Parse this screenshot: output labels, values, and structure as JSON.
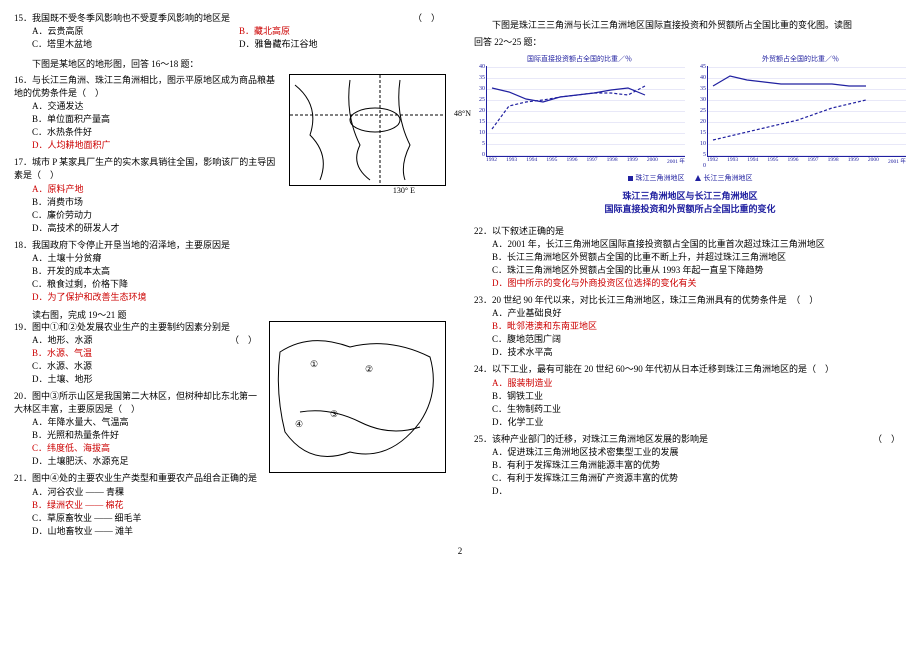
{
  "page_number": "2",
  "left": {
    "q15": {
      "num": "15．",
      "text": "我国既不受冬季风影响也不受夏季风影响的地区是",
      "paren": "（　）",
      "A": "A．云贵高原",
      "B": "B．藏北高原",
      "C": "C．塔里木盆地",
      "D": "D．雅鲁藏布江谷地"
    },
    "intro1": "下图是某地区的地形图，回答 16～18 题：",
    "map1": {
      "lat": "48°N",
      "lon": "130° E"
    },
    "q16": {
      "num": "16．",
      "text": "与长江三角洲、珠江三角洲相比，图示平原地区成为商品粮基地的优势条件是（　）",
      "A": "A．交通发达",
      "B": "B．单位面积产量高",
      "C": "C．水热条件好",
      "D": "D．人均耕地面积广"
    },
    "q17": {
      "num": "17．",
      "text": "城市 P 某家具厂生产的实木家具销往全国，影响该厂的主导因素是（　）",
      "A": "A．原料产地",
      "B": "B．消费市场",
      "C": "C．廉价劳动力",
      "D": "D．高技术的研发人才"
    },
    "q18": {
      "num": "18．",
      "text": "我国政府下令停止开垦当地的沼泽地，主要原因是",
      "A": "A．土壤十分贫瘠",
      "B": "B．开发的成本太高",
      "C": "C．粮食过剩，价格下降",
      "D": "D．为了保护和改善生态环境"
    },
    "intro2": "读右图，完成 19～21 题",
    "q19": {
      "num": "19．",
      "text": "图中①和②处发展农业生产的主要制约因素分别是",
      "paren": "（　）",
      "A": "A．地形、水源",
      "B": "B．水源、气温",
      "C": "C．水源、水源",
      "D": "D．土壤、地形"
    },
    "q20": {
      "num": "20．",
      "text": "图中③所示山区是我国第二大林区，但树种却比东北第一大林区丰富，主要原因是（　）",
      "A": "A．年降水量大、气温高",
      "B": "B．光照和热量条件好",
      "C": "C．纬度低、海拔高",
      "D": "D．土壤肥沃、水源充足"
    },
    "q21": {
      "num": "21．",
      "text": "图中④处的主要农业生产类型和重要农产品组合正确的是",
      "A": "A．河谷农业 —— 青稞",
      "B": "B．绿洲农业 —— 棉花",
      "C": "C．草原畜牧业 —— 细毛羊",
      "D": "D．山地畜牧业 —— 滩羊"
    }
  },
  "right": {
    "intro3": "下图是珠江三三角洲与长江三角洲地区国际直接投资和外贸额所占全国比重的变化图。读图",
    "intro3b": "回答 22～25 题：",
    "chart1_title": "国际直接投资额占全国的比重／％",
    "chart2_title": "外贸额占全国的比重／％",
    "legend1": "珠江三角洲地区",
    "legend2": "长江三角洲地区",
    "caption1": "珠江三角洲地区与长江三角洲地区",
    "caption2": "国际直接投资和外贸额所占全国比重的变化",
    "q22": {
      "num": "22．",
      "text": "以下叙述正确的是",
      "A": "A．2001 年，长江三角洲地区国际直接投资额占全国的比重首次超过珠江三角洲地区",
      "B": "B．长江三角洲地区外贸额占全国的比重不断上升，并超过珠江三角洲地区",
      "C": "C．珠江三角洲地区外贸额占全国的比重从 1993 年起一直呈下降趋势",
      "D": "D．图中所示的变化与外商投资区位选择的变化有关"
    },
    "q23": {
      "num": "23．",
      "text": "20 世纪 90 年代以来，对比长江三角洲地区，珠江三角洲具有的优势条件是　（　）",
      "A": "A．产业基础良好",
      "B": "B．毗邻港澳和东南亚地区",
      "C": "C．腹地范围广阔",
      "D": "D．技术水平高"
    },
    "q24": {
      "num": "24．",
      "text": "以下工业，最有可能在 20 世纪 60～90 年代初从日本迁移到珠江三角洲地区的是（　）",
      "A": "A．服装制造业",
      "B": "B．钢铁工业",
      "C": "C．生物制药工业",
      "D": "D．化学工业"
    },
    "q25": {
      "num": "25．",
      "text": "该种产业部门的迁移，对珠江三角洲地区发展的影响是",
      "paren": "（　）",
      "A": "A．促进珠江三角洲地区技术密集型工业的发展",
      "B": "B．有利于发挥珠江三角洲能源丰富的优势",
      "C": "C．有利于发挥珠江三角洲矿产资源丰富的优势",
      "D_prefix": "D．"
    }
  },
  "chart_data": [
    {
      "type": "line",
      "title": "国际直接投资额占全国的比重／％",
      "xlabel": "年",
      "ylabel": "％",
      "ylim": [
        0,
        40
      ],
      "x": [
        1992,
        1993,
        1994,
        1995,
        1996,
        1997,
        1998,
        1999,
        2000,
        2001
      ],
      "series": [
        {
          "name": "珠江三角洲地区",
          "values": [
            30,
            28,
            25,
            24,
            26,
            27,
            28,
            29,
            30,
            27
          ]
        },
        {
          "name": "长江三角洲地区",
          "values": [
            12,
            22,
            24,
            25,
            26,
            27,
            28,
            28,
            27,
            31
          ]
        }
      ]
    },
    {
      "type": "line",
      "title": "外贸额占全国的比重／％",
      "xlabel": "年",
      "ylabel": "％",
      "ylim": [
        0,
        45
      ],
      "x": [
        1992,
        1993,
        1994,
        1995,
        1996,
        1997,
        1998,
        1999,
        2000,
        2001
      ],
      "series": [
        {
          "name": "珠江三角洲地区",
          "values": [
            35,
            40,
            38,
            37,
            36,
            36,
            36,
            36,
            35,
            35
          ]
        },
        {
          "name": "长江三角洲地区",
          "values": [
            8,
            10,
            12,
            14,
            16,
            18,
            21,
            24,
            26,
            28
          ]
        }
      ]
    }
  ]
}
